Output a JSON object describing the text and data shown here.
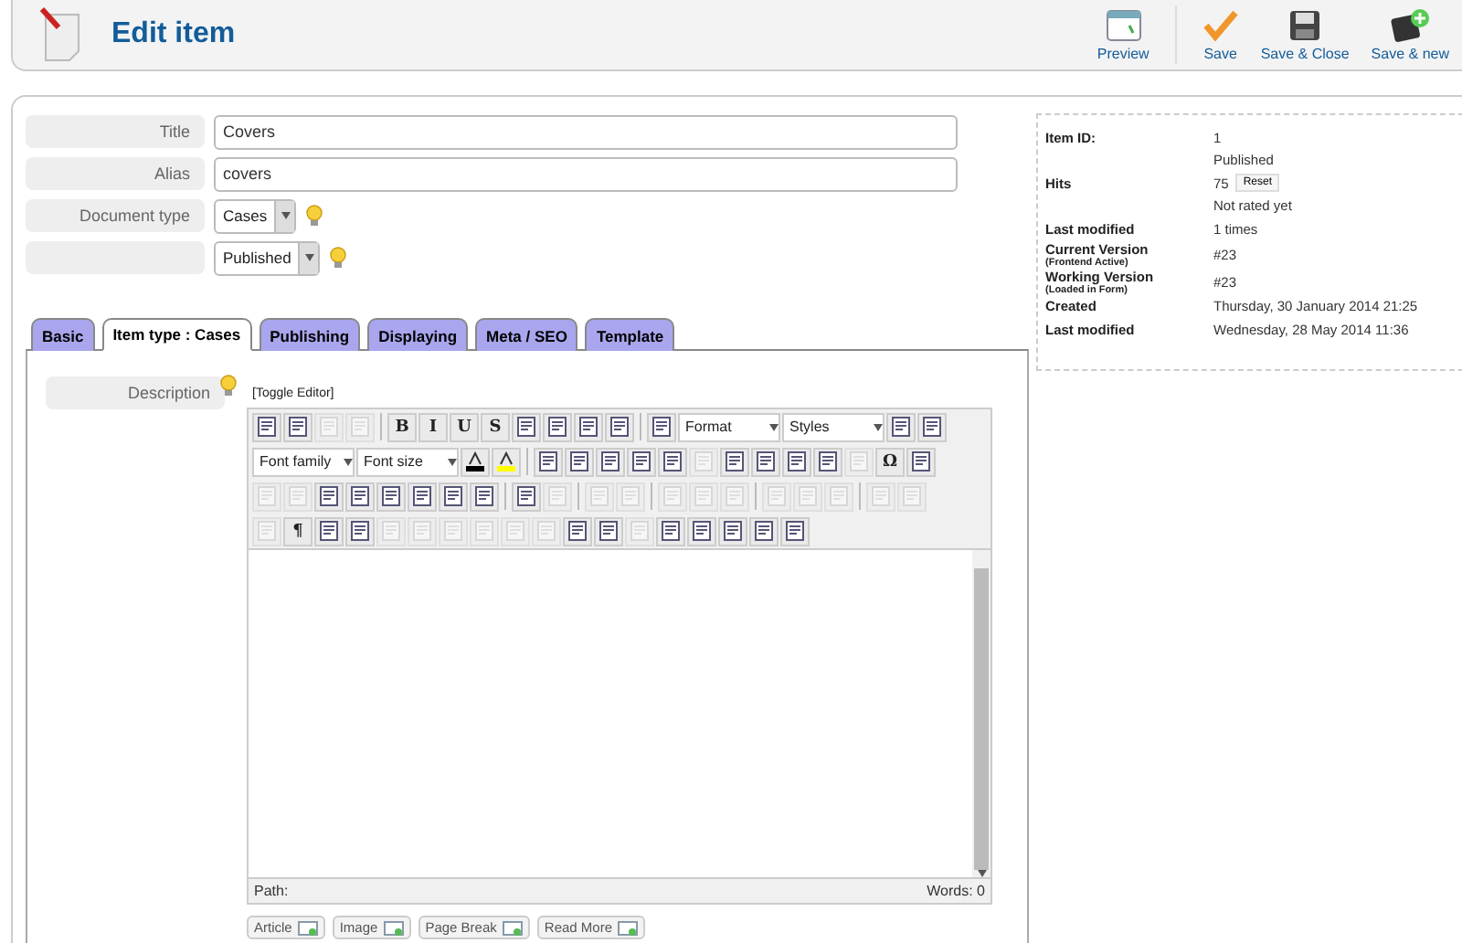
{
  "header": {
    "title": "Edit item",
    "actions": [
      {
        "label": "Preview",
        "kind": "preview"
      },
      {
        "label": "Save",
        "kind": "save"
      },
      {
        "label": "Save & Close",
        "kind": "save-close"
      },
      {
        "label": "Save & new",
        "kind": "save-new"
      }
    ]
  },
  "fields": [
    {
      "label": "Title",
      "kind": "text",
      "value": "Covers"
    },
    {
      "label": "Alias",
      "kind": "text",
      "value": "covers"
    },
    {
      "label": "Document type",
      "kind": "select",
      "value": "Cases"
    },
    {
      "kind": "select",
      "value": "Published"
    }
  ],
  "tabs": [
    {
      "label": "Basic",
      "selected": false
    },
    {
      "label": "Item type : Cases",
      "selected": true
    },
    {
      "label": "Publishing",
      "selected": false
    },
    {
      "label": "Displaying",
      "selected": false
    },
    {
      "label": "Meta / SEO",
      "selected": false
    },
    {
      "label": "Template",
      "selected": false
    }
  ],
  "info": [
    {
      "label": "Item ID:",
      "value": "1"
    },
    {
      "value": "Published"
    },
    {
      "label": "Hits",
      "value": "75",
      "button": "Reset"
    },
    {
      "value": "Not rated yet"
    },
    {
      "label": "Last modified",
      "value": "1 times"
    },
    {
      "label": "Current Version",
      "sublabel": "(Frontend Active)",
      "value": "#23"
    },
    {
      "label": "Working Version",
      "sublabel": "(Loaded in Form)",
      "value": "#23"
    },
    {
      "label": "Created",
      "value": "Thursday, 30 January 2014 21:25"
    },
    {
      "label": "Last modified",
      "value": "Wednesday, 28 May 2014 11:36"
    }
  ],
  "editor": {
    "label": "Description",
    "toggle": "[Toggle Editor]",
    "toolbar": [
      [
        {
          "kind": "icon",
          "disabled": false
        },
        {
          "kind": "icon",
          "disabled": false
        },
        {
          "kind": "icon",
          "disabled": true
        },
        {
          "kind": "icon",
          "disabled": true
        },
        {
          "kind": "separator"
        },
        {
          "kind": "glyph",
          "text": "B"
        },
        {
          "kind": "glyph",
          "text": "I"
        },
        {
          "kind": "glyph",
          "text": "U"
        },
        {
          "kind": "glyph",
          "text": "S"
        },
        {
          "kind": "icon",
          "disabled": false
        },
        {
          "kind": "icon",
          "disabled": false
        },
        {
          "kind": "icon",
          "disabled": false
        },
        {
          "kind": "icon",
          "disabled": false
        },
        {
          "kind": "separator"
        },
        {
          "kind": "icon",
          "disabled": false
        },
        {
          "kind": "select",
          "text": "Format"
        },
        {
          "kind": "select",
          "text": "Styles"
        },
        {
          "kind": "icon",
          "disabled": false
        },
        {
          "kind": "icon",
          "disabled": false
        }
      ],
      [
        {
          "kind": "select",
          "text": "Font family"
        },
        {
          "kind": "select",
          "text": "Font size"
        },
        {
          "kind": "color",
          "color": "#000000"
        },
        {
          "kind": "color",
          "color": "#ffff00"
        },
        {
          "kind": "separator"
        },
        {
          "kind": "icon",
          "disabled": false
        },
        {
          "kind": "icon",
          "disabled": false
        },
        {
          "kind": "icon",
          "disabled": false
        },
        {
          "kind": "icon",
          "disabled": false
        },
        {
          "kind": "icon",
          "disabled": false
        },
        {
          "kind": "icon",
          "disabled": true
        },
        {
          "kind": "icon",
          "disabled": false
        },
        {
          "kind": "icon",
          "disabled": false
        },
        {
          "kind": "icon",
          "disabled": false
        },
        {
          "kind": "icon",
          "disabled": false
        },
        {
          "kind": "icon",
          "disabled": true
        },
        {
          "kind": "glyph",
          "text": "Ω"
        },
        {
          "kind": "icon",
          "disabled": false
        }
      ],
      [
        {
          "kind": "icon",
          "disabled": true
        },
        {
          "kind": "icon",
          "disabled": true
        },
        {
          "kind": "icon",
          "disabled": false
        },
        {
          "kind": "icon",
          "disabled": false
        },
        {
          "kind": "icon",
          "disabled": false
        },
        {
          "kind": "icon",
          "disabled": false
        },
        {
          "kind": "icon",
          "disabled": false
        },
        {
          "kind": "icon",
          "disabled": false
        },
        {
          "kind": "separator"
        },
        {
          "kind": "icon",
          "disabled": false
        },
        {
          "kind": "icon",
          "disabled": true
        },
        {
          "kind": "separator"
        },
        {
          "kind": "icon",
          "disabled": true
        },
        {
          "kind": "icon",
          "disabled": true
        },
        {
          "kind": "separator"
        },
        {
          "kind": "icon",
          "disabled": true
        },
        {
          "kind": "icon",
          "disabled": true
        },
        {
          "kind": "icon",
          "disabled": true
        },
        {
          "kind": "separator"
        },
        {
          "kind": "icon",
          "disabled": true
        },
        {
          "kind": "icon",
          "disabled": true
        },
        {
          "kind": "icon",
          "disabled": true
        },
        {
          "kind": "separator"
        },
        {
          "kind": "icon",
          "disabled": true
        },
        {
          "kind": "icon",
          "disabled": true
        }
      ],
      [
        {
          "kind": "icon",
          "disabled": true
        },
        {
          "kind": "glyph",
          "text": "¶"
        },
        {
          "kind": "icon",
          "disabled": false
        },
        {
          "kind": "icon",
          "disabled": false
        },
        {
          "kind": "icon",
          "disabled": true
        },
        {
          "kind": "icon",
          "disabled": true
        },
        {
          "kind": "icon",
          "disabled": true
        },
        {
          "kind": "icon",
          "disabled": true
        },
        {
          "kind": "icon",
          "disabled": true
        },
        {
          "kind": "icon",
          "disabled": true
        },
        {
          "kind": "icon",
          "disabled": false
        },
        {
          "kind": "icon",
          "disabled": false
        },
        {
          "kind": "icon",
          "disabled": true
        },
        {
          "kind": "icon",
          "disabled": false
        },
        {
          "kind": "icon",
          "disabled": false
        },
        {
          "kind": "icon",
          "disabled": false
        },
        {
          "kind": "icon",
          "disabled": false
        },
        {
          "kind": "icon",
          "disabled": false
        }
      ]
    ],
    "path": "Path:",
    "words": "Words: 0",
    "buttons": [
      "Article",
      "Image",
      "Page Break",
      "Read More"
    ]
  }
}
